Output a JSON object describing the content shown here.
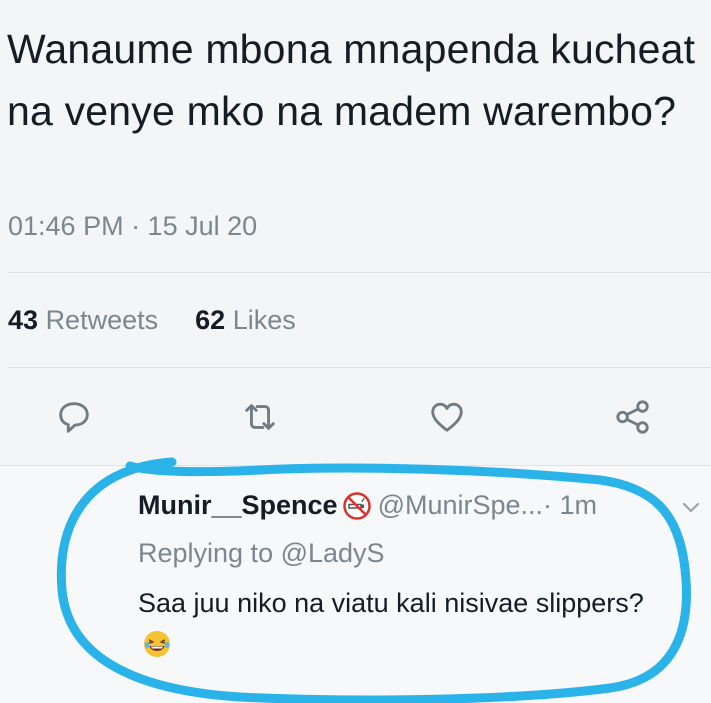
{
  "tweet": {
    "text": "Wanaume mbona mnapenda kucheat na venye mko na madem warembo?",
    "timestamp": "01:46 PM · 15 Jul 20",
    "retweets_count": "43",
    "retweets_label": "Retweets",
    "likes_count": "62",
    "likes_label": "Likes"
  },
  "actions": {
    "reply_icon": "speech-bubble-icon",
    "retweet_icon": "retweet-icon",
    "like_icon": "heart-icon",
    "share_icon": "share-icon"
  },
  "reply": {
    "name": "Munir__Spence",
    "name_emoji": "no-smoking-icon",
    "handle": "@MunirSpe...",
    "time": " · 1m",
    "replying_prefix": "Replying to ",
    "replying_handle": "@LadyS",
    "text": "Saa juu niko na viatu kali nisivae slippers?",
    "text_emoji": "laughing-emoji"
  },
  "colors": {
    "muted_text": "#7b8790",
    "primary_text": "#141d26",
    "highlight_circle": "#2ab3e8",
    "divider": "#dfe3e6"
  }
}
